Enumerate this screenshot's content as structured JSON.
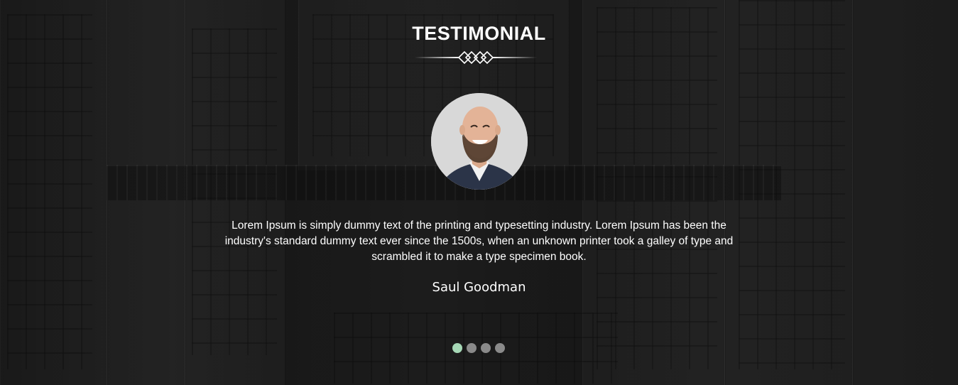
{
  "testimonial": {
    "title": "TESTIMONIAL",
    "quote": "Lorem Ipsum is simply dummy text of the printing and typesetting industry. Lorem Ipsum has been the industry's standard dummy text ever since the 1500s, when an unknown printer took a galley of type and scrambled it to make a type specimen book.",
    "author": "Saul Goodman",
    "avatar_alt": "smiling bald bearded man in suit",
    "carousel": {
      "count": 4,
      "active_index": 0
    }
  },
  "colors": {
    "active_dot": "#a6d8b6",
    "inactive_dot": "#8a8a8a",
    "text": "#ffffff"
  }
}
